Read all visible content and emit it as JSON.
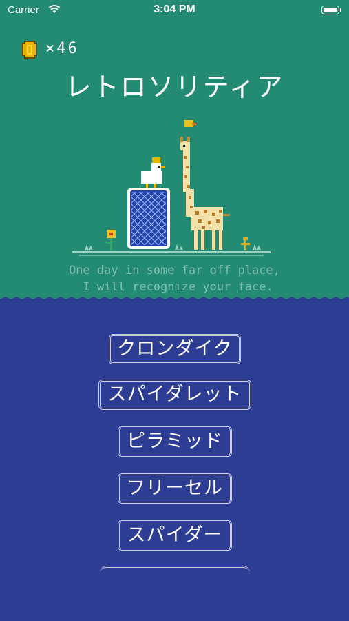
{
  "status_bar": {
    "carrier": "Carrier",
    "time": "3:04 PM"
  },
  "coins": {
    "multiplier": "×46"
  },
  "title": "レトロソリティア",
  "tagline": "One day in some far off place,\n I will recognize your face.",
  "menu": {
    "klondike": "クロンダイク",
    "spider_ret": "スパイダレット",
    "pyramid": "ピラミッド",
    "freecell": "フリーセル",
    "spider": "スパイダー"
  },
  "colors": {
    "top_bg": "#238a73",
    "bottom_bg": "#2e3d94",
    "button_border": "#c9cde8"
  }
}
